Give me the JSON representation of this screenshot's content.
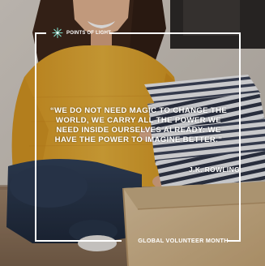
{
  "brand": {
    "logo_label": "POINTS OF LIGHT",
    "logo_icon": "star-burst-icon",
    "accent_color": "#7ed6c4"
  },
  "quote": {
    "text": "“WE DO NOT NEED MAGIC TO CHANGE THE WORLD, WE CARRY ALL THE POWER WE NEED INSIDE OURSELVES ALREADY: WE HAVE THE POWER TO IMAGINE BETTER.”",
    "author": "J.K. ROWLING"
  },
  "footer": {
    "campaign_label": "GLOBAL VOLUNTEER MONTH"
  },
  "colors": {
    "text": "#ffffff",
    "frame": "#ffffff",
    "sweater": "#e1a72a",
    "jeans": "#223247",
    "box": "#d9bf98"
  }
}
